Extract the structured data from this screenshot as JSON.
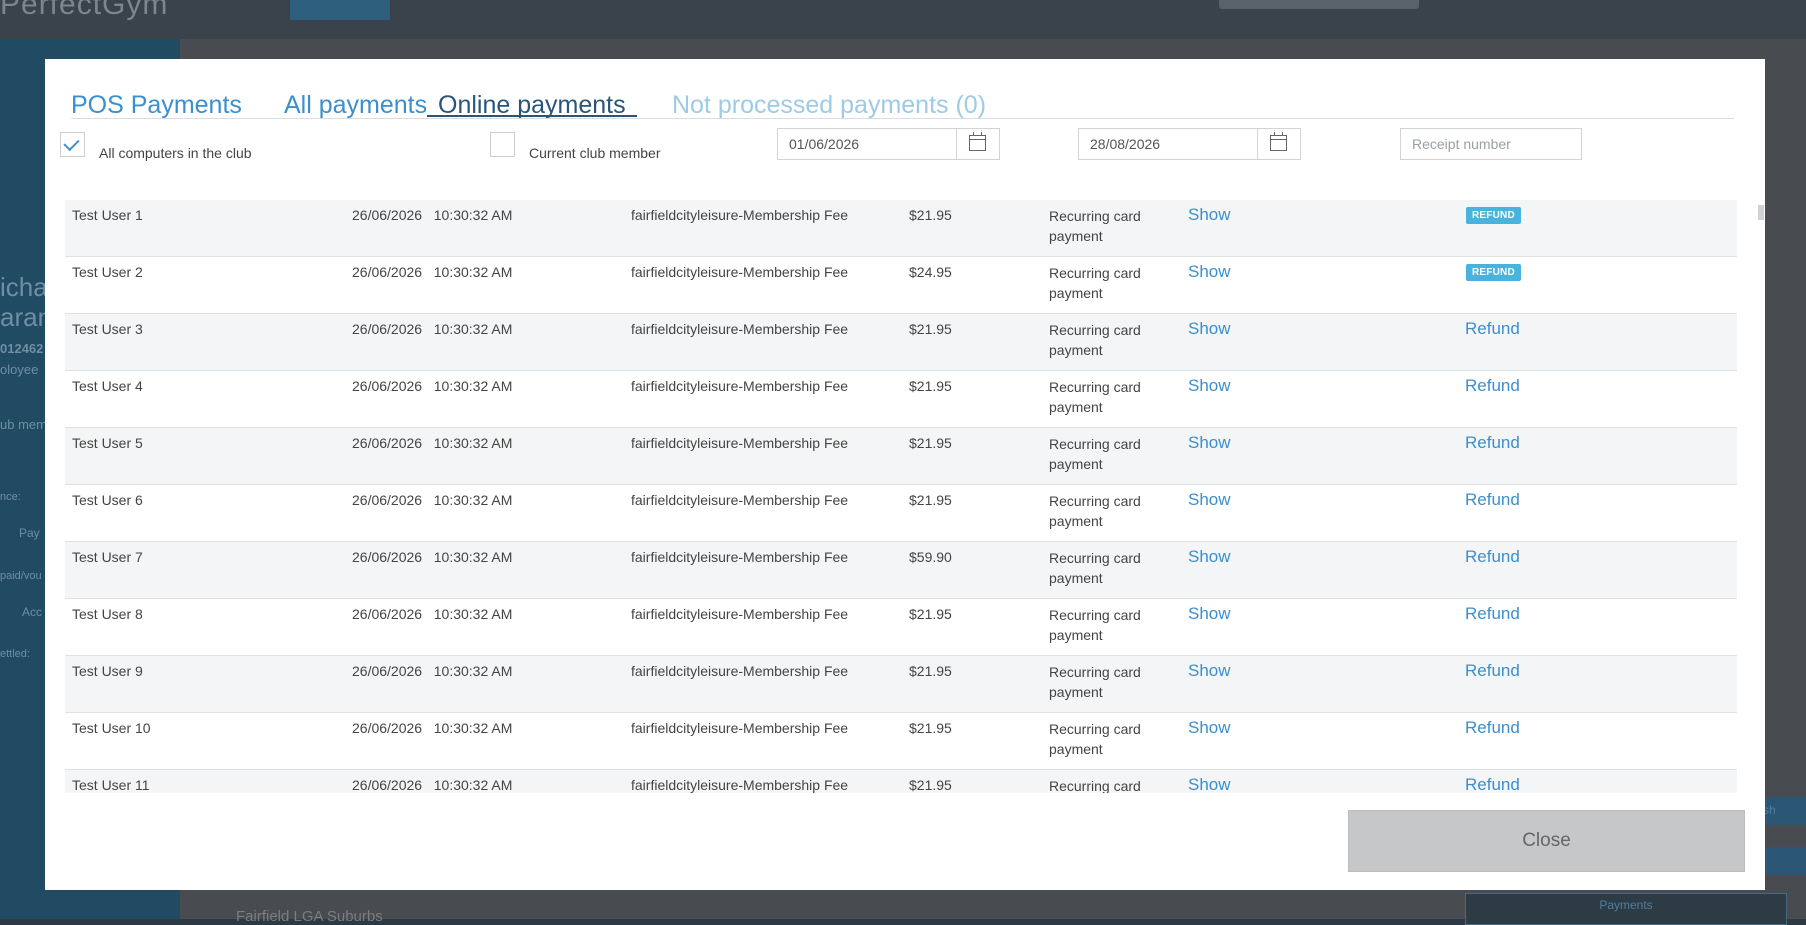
{
  "background": {
    "logo": "PerfectGym",
    "sidebar_texts": [
      "icha",
      "aran",
      "012462",
      "oloyee",
      "ub mem",
      "nce:",
      "Pay",
      "paid/vou",
      "Acc",
      "ettled:"
    ],
    "bottom_label": "Fairfield LGA Suburbs",
    "payments_button": "Payments",
    "right_button": "sh"
  },
  "tabs": [
    {
      "label": "POS Payments"
    },
    {
      "label": "All payments"
    },
    {
      "label": "Online payments"
    },
    {
      "label": "Not processed payments (0)"
    }
  ],
  "filters": {
    "all_computers_label": "All computers in the club",
    "all_computers_checked": true,
    "current_member_label": "Current club member",
    "current_member_checked": false,
    "date_from": "01/06/2026",
    "date_to": "28/08/2026",
    "receipt_placeholder": "Receipt number"
  },
  "rows": [
    {
      "name": "Test User 1",
      "date": "26/06/2026",
      "time": "10:30:32 AM",
      "description": "fairfieldcityleisure-Membership Fee",
      "amount": "$21.95",
      "type": "Recurring card payment",
      "show": "Show",
      "action": "REFUND",
      "action_style": "badge"
    },
    {
      "name": "Test User 2",
      "date": "26/06/2026",
      "time": "10:30:32 AM",
      "description": "fairfieldcityleisure-Membership Fee",
      "amount": "$24.95",
      "type": "Recurring card payment",
      "show": "Show",
      "action": "REFUND",
      "action_style": "badge"
    },
    {
      "name": "Test User 3",
      "date": "26/06/2026",
      "time": "10:30:32 AM",
      "description": "fairfieldcityleisure-Membership Fee",
      "amount": "$21.95",
      "type": "Recurring card payment",
      "show": "Show",
      "action": "Refund",
      "action_style": "link"
    },
    {
      "name": "Test User 4",
      "date": "26/06/2026",
      "time": "10:30:32 AM",
      "description": "fairfieldcityleisure-Membership Fee",
      "amount": "$21.95",
      "type": "Recurring card payment",
      "show": "Show",
      "action": "Refund",
      "action_style": "link"
    },
    {
      "name": "Test User 5",
      "date": "26/06/2026",
      "time": "10:30:32 AM",
      "description": "fairfieldcityleisure-Membership Fee",
      "amount": "$21.95",
      "type": "Recurring card payment",
      "show": "Show",
      "action": "Refund",
      "action_style": "link"
    },
    {
      "name": "Test User 6",
      "date": "26/06/2026",
      "time": "10:30:32 AM",
      "description": "fairfieldcityleisure-Membership Fee",
      "amount": "$21.95",
      "type": "Recurring card payment",
      "show": "Show",
      "action": "Refund",
      "action_style": "link"
    },
    {
      "name": "Test User 7",
      "date": "26/06/2026",
      "time": "10:30:32 AM",
      "description": "fairfieldcityleisure-Membership Fee",
      "amount": "$59.90",
      "type": "Recurring card payment",
      "show": "Show",
      "action": "Refund",
      "action_style": "link"
    },
    {
      "name": "Test User 8",
      "date": "26/06/2026",
      "time": "10:30:32 AM",
      "description": "fairfieldcityleisure-Membership Fee",
      "amount": "$21.95",
      "type": "Recurring card payment",
      "show": "Show",
      "action": "Refund",
      "action_style": "link"
    },
    {
      "name": "Test User 9",
      "date": "26/06/2026",
      "time": "10:30:32 AM",
      "description": "fairfieldcityleisure-Membership Fee",
      "amount": "$21.95",
      "type": "Recurring card payment",
      "show": "Show",
      "action": "Refund",
      "action_style": "link"
    },
    {
      "name": "Test User 10",
      "date": "26/06/2026",
      "time": "10:30:32 AM",
      "description": "fairfieldcityleisure-Membership Fee",
      "amount": "$21.95",
      "type": "Recurring card payment",
      "show": "Show",
      "action": "Refund",
      "action_style": "link"
    },
    {
      "name": "Test User 11",
      "date": "26/06/2026",
      "time": "10:30:32 AM",
      "description": "fairfieldcityleisure-Membership Fee",
      "amount": "$21.95",
      "type": "Recurring card",
      "show": "Show",
      "action": "Refund",
      "action_style": "link"
    }
  ],
  "close_label": "Close",
  "colors": {
    "accent": "#3b8fcc",
    "active_tab": "#2a5578",
    "badge": "#48b3dc"
  }
}
